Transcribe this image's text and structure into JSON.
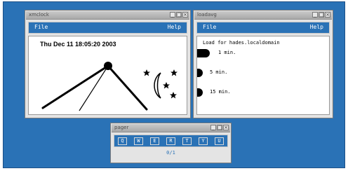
{
  "windows": {
    "clock": {
      "title": "xmclock",
      "menu": {
        "file": "File",
        "help": "Help"
      },
      "date_text": "Thu Dec 11 18:05:20 2003"
    },
    "loadavg": {
      "title": "loadavg",
      "menu": {
        "file": "File",
        "help": "Help"
      },
      "header": "Load for hades.localdomain",
      "rows": [
        {
          "label": "1 min.",
          "level": 0.15
        },
        {
          "label": "5 min.",
          "level": 0.04
        },
        {
          "label": "15 min.",
          "level": 0.04
        }
      ]
    },
    "pager": {
      "title": "pager",
      "buttons": [
        "Q",
        "W",
        "E",
        "R",
        "T",
        "Y",
        "U"
      ],
      "status": "0/1"
    }
  },
  "titlebar_buttons": {
    "minimize": "_",
    "maximize": "□",
    "close": "×"
  },
  "colors": {
    "desktop": "#2a72b6",
    "titlebar": "#b8b8b8",
    "window": "#e4e4e4"
  }
}
